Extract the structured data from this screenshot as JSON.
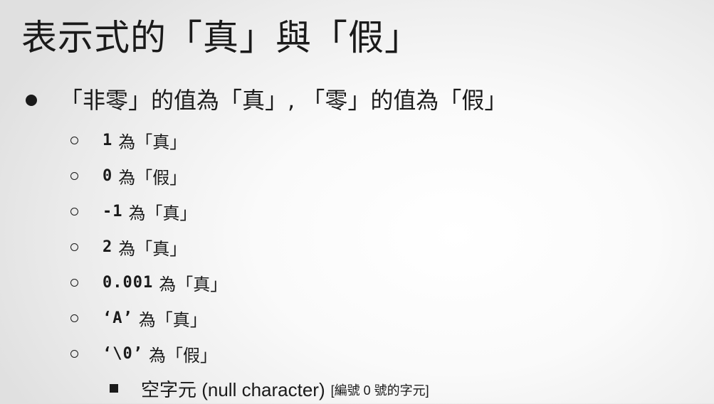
{
  "slide": {
    "title": "表示式的「真」與「假」",
    "bullet": {
      "text": "「非零」的值為「真」, 「零」的值為「假」",
      "icon": "bullet-dot"
    },
    "examples": [
      {
        "code": "1",
        "desc": "為「真」"
      },
      {
        "code": "0",
        "desc": "為「假」"
      },
      {
        "code": "-1",
        "desc": "為「真」"
      },
      {
        "code": "2",
        "desc": "為「真」"
      },
      {
        "code": "0.001",
        "desc": "為「真」"
      },
      {
        "code": "‘A’",
        "desc": "為「真」"
      },
      {
        "code": "‘\\0’",
        "desc": "為「假」"
      }
    ],
    "note": {
      "text": "空字元 (null character)",
      "detail": "[編號 0 號的字元]",
      "icon": "bullet-square"
    }
  },
  "colors": {
    "text": "#1a1a1a",
    "background": "#ffffff"
  }
}
